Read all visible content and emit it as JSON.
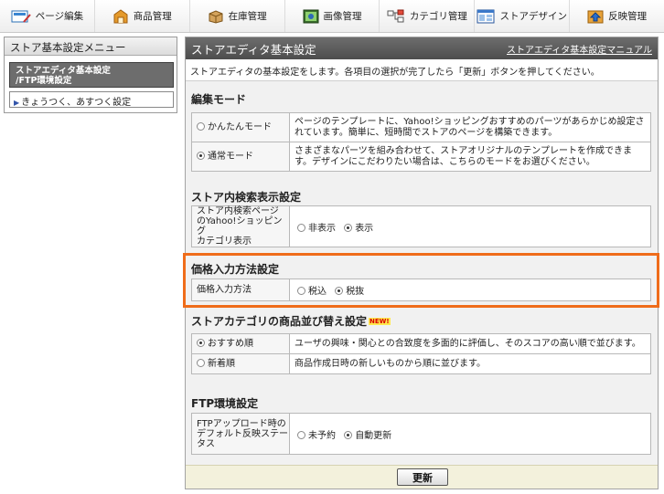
{
  "nav": {
    "items": [
      {
        "label": "ページ編集",
        "icon": "page-edit-icon"
      },
      {
        "label": "商品管理",
        "icon": "product-icon"
      },
      {
        "label": "在庫管理",
        "icon": "inventory-box-icon"
      },
      {
        "label": "画像管理",
        "icon": "image-icon"
      },
      {
        "label": "カテゴリ管理",
        "icon": "category-tree-icon"
      },
      {
        "label": "ストアデザイン",
        "icon": "store-design-icon"
      },
      {
        "label": "反映管理",
        "icon": "publish-icon"
      }
    ]
  },
  "sidebar": {
    "title": "ストア基本設定メニュー",
    "active_line1": "ストアエディタ基本設定",
    "active_line2": "/FTP環境設定",
    "item": "きょうつく、あすつく設定"
  },
  "panel": {
    "title": "ストアエディタ基本設定",
    "manual_link": "ストアエディタ基本設定マニュアル",
    "description": "ストアエディタの基本設定をします。各項目の選択が完了したら「更新」ボタンを押してください。"
  },
  "edit_mode": {
    "title": "編集モード",
    "rows": [
      {
        "label": "かんたんモード",
        "selected": false,
        "desc": "ページのテンプレートに、Yahoo!ショッピングおすすめのパーツがあらかじめ設定されています。簡単に、短時間でストアのページを構築できます。"
      },
      {
        "label": "通常モード",
        "selected": true,
        "desc": "さまざまなパーツを組み合わせて、ストアオリジナルのテンプレートを作成できます。デザインにこだわりたい場合は、こちらのモードをお選びください。"
      }
    ]
  },
  "search_display": {
    "title": "ストア内検索表示設定",
    "label_lines": [
      "ストア内検索ページ",
      "のYahoo!ショッピング",
      "カテゴリ表示"
    ],
    "options": [
      {
        "label": "非表示",
        "selected": false
      },
      {
        "label": "表示",
        "selected": true
      }
    ]
  },
  "price_input": {
    "title": "価格入力方法設定",
    "label": "価格入力方法",
    "options": [
      {
        "label": "税込",
        "selected": false
      },
      {
        "label": "税抜",
        "selected": true
      }
    ]
  },
  "category_sort": {
    "title": "ストアカテゴリの商品並び替え設定",
    "badge": "NEW!",
    "rows": [
      {
        "label": "おすすめ順",
        "selected": true,
        "desc": "ユーザの興味・関心との合致度を多面的に評価し、そのスコアの高い順で並びます。"
      },
      {
        "label": "新着順",
        "selected": false,
        "desc": "商品作成日時の新しいものから順に並びます。"
      }
    ]
  },
  "ftp": {
    "title": "FTP環境設定",
    "label_lines": [
      "FTPアップロード時の",
      "デフォルト反映ステー",
      "タス"
    ],
    "options": [
      {
        "label": "未予約",
        "selected": false
      },
      {
        "label": "自動更新",
        "selected": true
      }
    ]
  },
  "footer": {
    "update_button": "更新"
  },
  "colors": {
    "highlight": "#ef6c1a",
    "header": "#5a5a5a",
    "footer": "#f3f1dc"
  }
}
